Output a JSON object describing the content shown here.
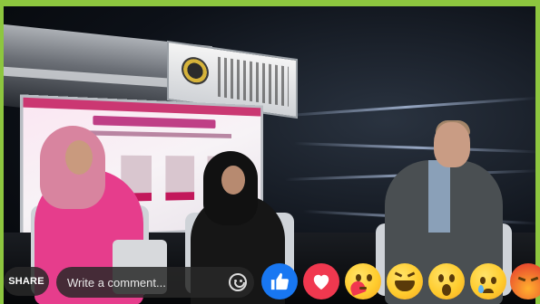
{
  "video": {
    "description_alt": ""
  },
  "controls": {
    "share_label": "SHARE",
    "comment_placeholder": "Write a comment..."
  },
  "reactions": [
    "like-icon",
    "love-icon",
    "care-icon",
    "haha-icon",
    "wow-icon",
    "sad-icon",
    "angry-icon"
  ],
  "colors": {
    "frame_border": "#8dc63f",
    "like": "#1877f2",
    "love": "#f0384f",
    "overlay": "#282828"
  }
}
